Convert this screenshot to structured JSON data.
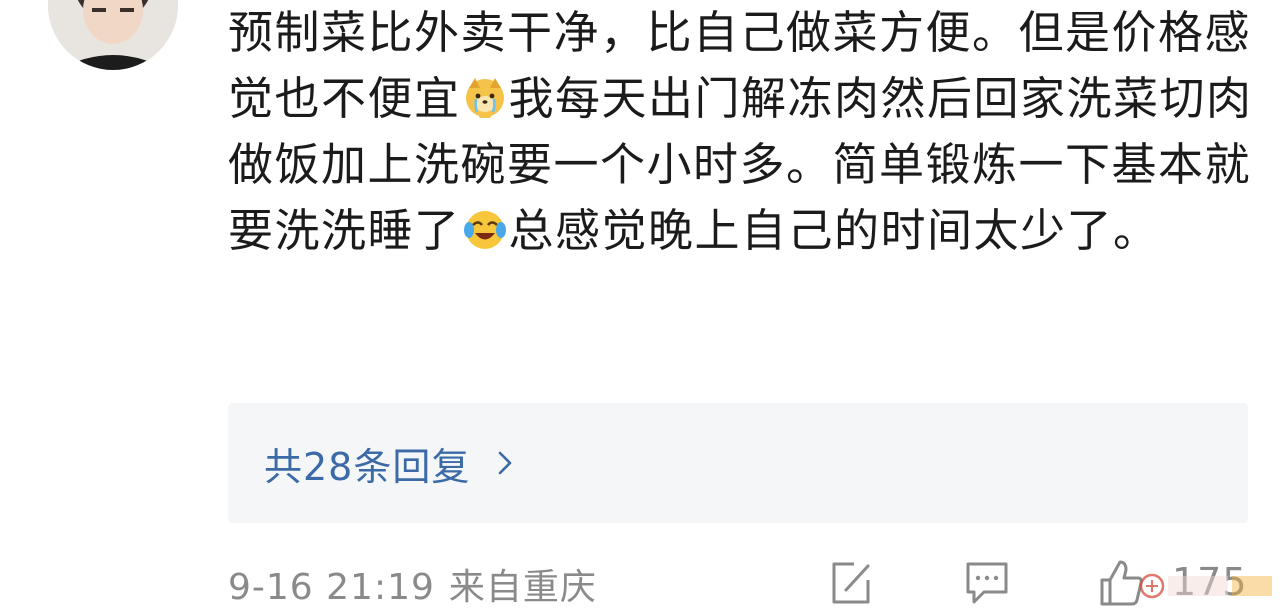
{
  "comment": {
    "text_part1": "预制菜比外卖干净，比自己做菜方便。但是价格感觉也不便宜",
    "emoji1": "crying-dog-emoji",
    "text_part2": "我每天出门解冻肉然后回家洗菜切肉做饭加上洗碗要一个小时多。简单锻炼一下基本就要洗洗睡了",
    "emoji2": "laugh-cry-emoji",
    "text_part3": "总感觉晚上自己的时间太少了。"
  },
  "replies": {
    "label": "共28条回复"
  },
  "meta": {
    "date": "9-16 21:19",
    "location": "来自重庆"
  },
  "actions": {
    "like_count": "175",
    "icons": [
      "edit-icon",
      "comment-icon",
      "thumbs-up-icon"
    ]
  },
  "colors": {
    "link": "#3b6aa6",
    "meta": "#8a8a8a",
    "reply_bg": "#f5f6f8"
  }
}
